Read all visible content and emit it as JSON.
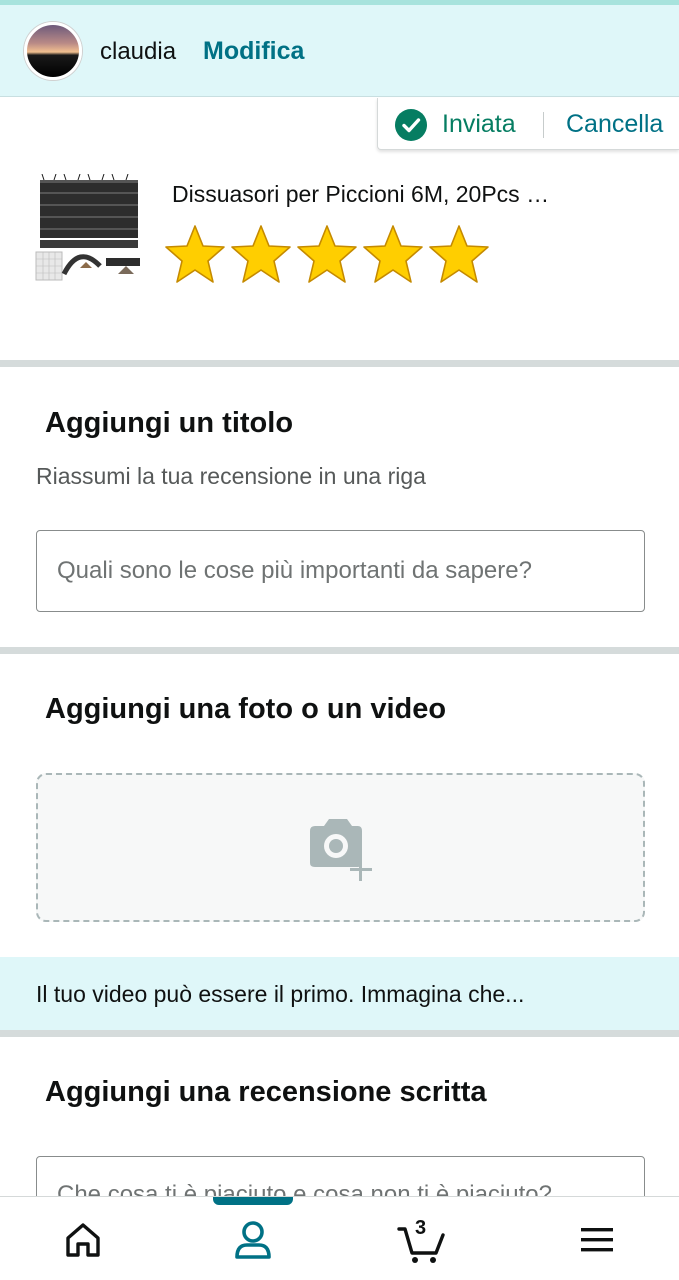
{
  "header": {
    "username": "claudia",
    "edit_label": "Modifica"
  },
  "status": {
    "sent_label": "Inviata",
    "cancel_label": "Cancella"
  },
  "product": {
    "title": "Dissuasori per Piccioni 6M, 20Pcs …",
    "rating": 5,
    "rating_max": 5,
    "star_color": "#ffce00"
  },
  "title_section": {
    "heading": "Aggiungi un titolo",
    "subheading": "Riassumi la tua recensione in una riga",
    "placeholder": "Quali sono le cose più importanti da sapere?"
  },
  "media_section": {
    "heading": "Aggiungi una foto o un video",
    "upload_icon": "camera-plus-icon"
  },
  "video_banner": {
    "text": "Il tuo video può essere il primo. Immagina che..."
  },
  "review_section": {
    "heading": "Aggiungi una recensione scritta",
    "placeholder": "Che cosa ti è piaciuto e cosa non ti è piaciuto?"
  },
  "bottom_nav": {
    "items": [
      {
        "icon": "home-icon"
      },
      {
        "icon": "profile-icon",
        "active": true
      },
      {
        "icon": "cart-icon",
        "badge": "3"
      },
      {
        "icon": "menu-icon"
      }
    ],
    "accent_color": "#007185"
  }
}
